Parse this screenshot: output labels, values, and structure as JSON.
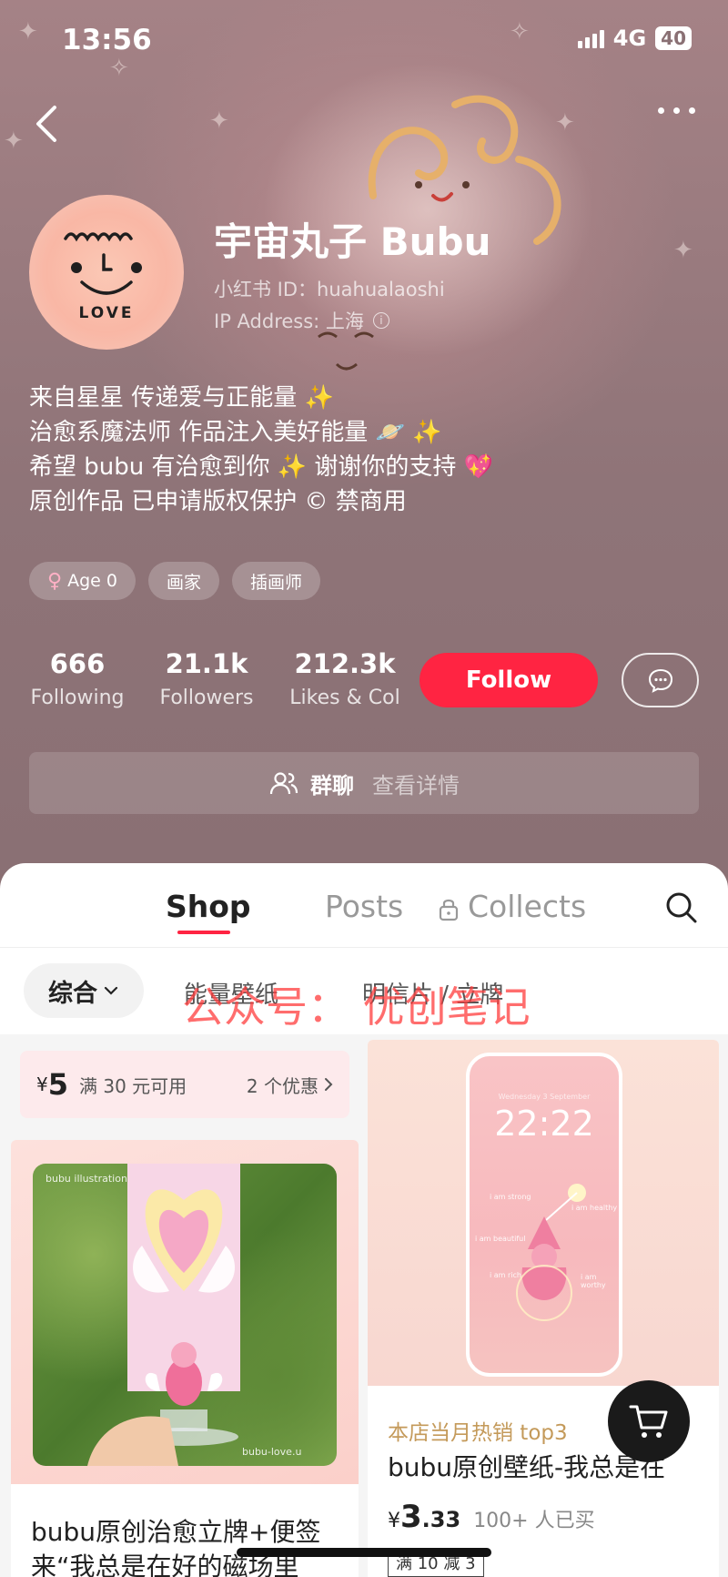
{
  "status_bar": {
    "time": "13:56",
    "network": "4G",
    "battery": "40"
  },
  "profile": {
    "name": "宇宙丸子 Bubu",
    "xhs_id": "小红书 ID：huahualaoshi",
    "ip_address": "IP Address: 上海",
    "avatar_text": "LOVE",
    "bio": [
      "来自星星  传递爱与正能量 ✨",
      "治愈系魔法师 作品注入美好能量 🪐 ✨",
      "希望 bubu 有治愈到你 ✨ 谢谢你的支持 💖",
      "原创作品 已申请版权保护 © 禁商用"
    ],
    "tags": [
      {
        "icon": "female-icon",
        "label": "Age 0"
      },
      {
        "label": "画家"
      },
      {
        "label": "插画师"
      }
    ]
  },
  "stats": {
    "following": {
      "value": "666",
      "label": "Following"
    },
    "followers": {
      "value": "21.1k",
      "label": "Followers"
    },
    "likes": {
      "value": "212.3k",
      "label": "Likes & Col"
    }
  },
  "actions": {
    "follow_label": "Follow"
  },
  "group_chat": {
    "title": "群聊",
    "detail": "查看详情"
  },
  "tabs": {
    "shop": "Shop",
    "posts": "Posts",
    "collects": "Collects"
  },
  "filters": {
    "selected": "综合",
    "options": [
      "能量壁纸",
      "明信片 / 立牌"
    ]
  },
  "watermark": "公众号：  优创笔记",
  "coupon": {
    "currency": "¥",
    "amount": "5",
    "condition": "满 30 元可用",
    "count": "2 个优惠"
  },
  "products": {
    "left": {
      "photo_label_top": "bubu illustration",
      "photo_label_bottom": "bubu-love.u",
      "title": "bubu原创治愈立牌+便签来“我总是在好的磁场里"
    },
    "right": {
      "phone_date": "Wednesday 3 September",
      "phone_time": "22:22",
      "phone_words": [
        "i am strong",
        "i am healthy",
        "i am beautiful",
        "i am rich",
        "i am worthy"
      ],
      "hot_label": "本店当月热销 top3",
      "title": "bubu原创壁纸-我总是在",
      "price_symbol": "¥",
      "price_int": "3",
      "price_dec": ".33",
      "sold": "100+ 人已买",
      "discount": "满 10 减 3"
    }
  },
  "colors": {
    "accent": "#ff2442",
    "hot_label": "#c49a5a"
  }
}
